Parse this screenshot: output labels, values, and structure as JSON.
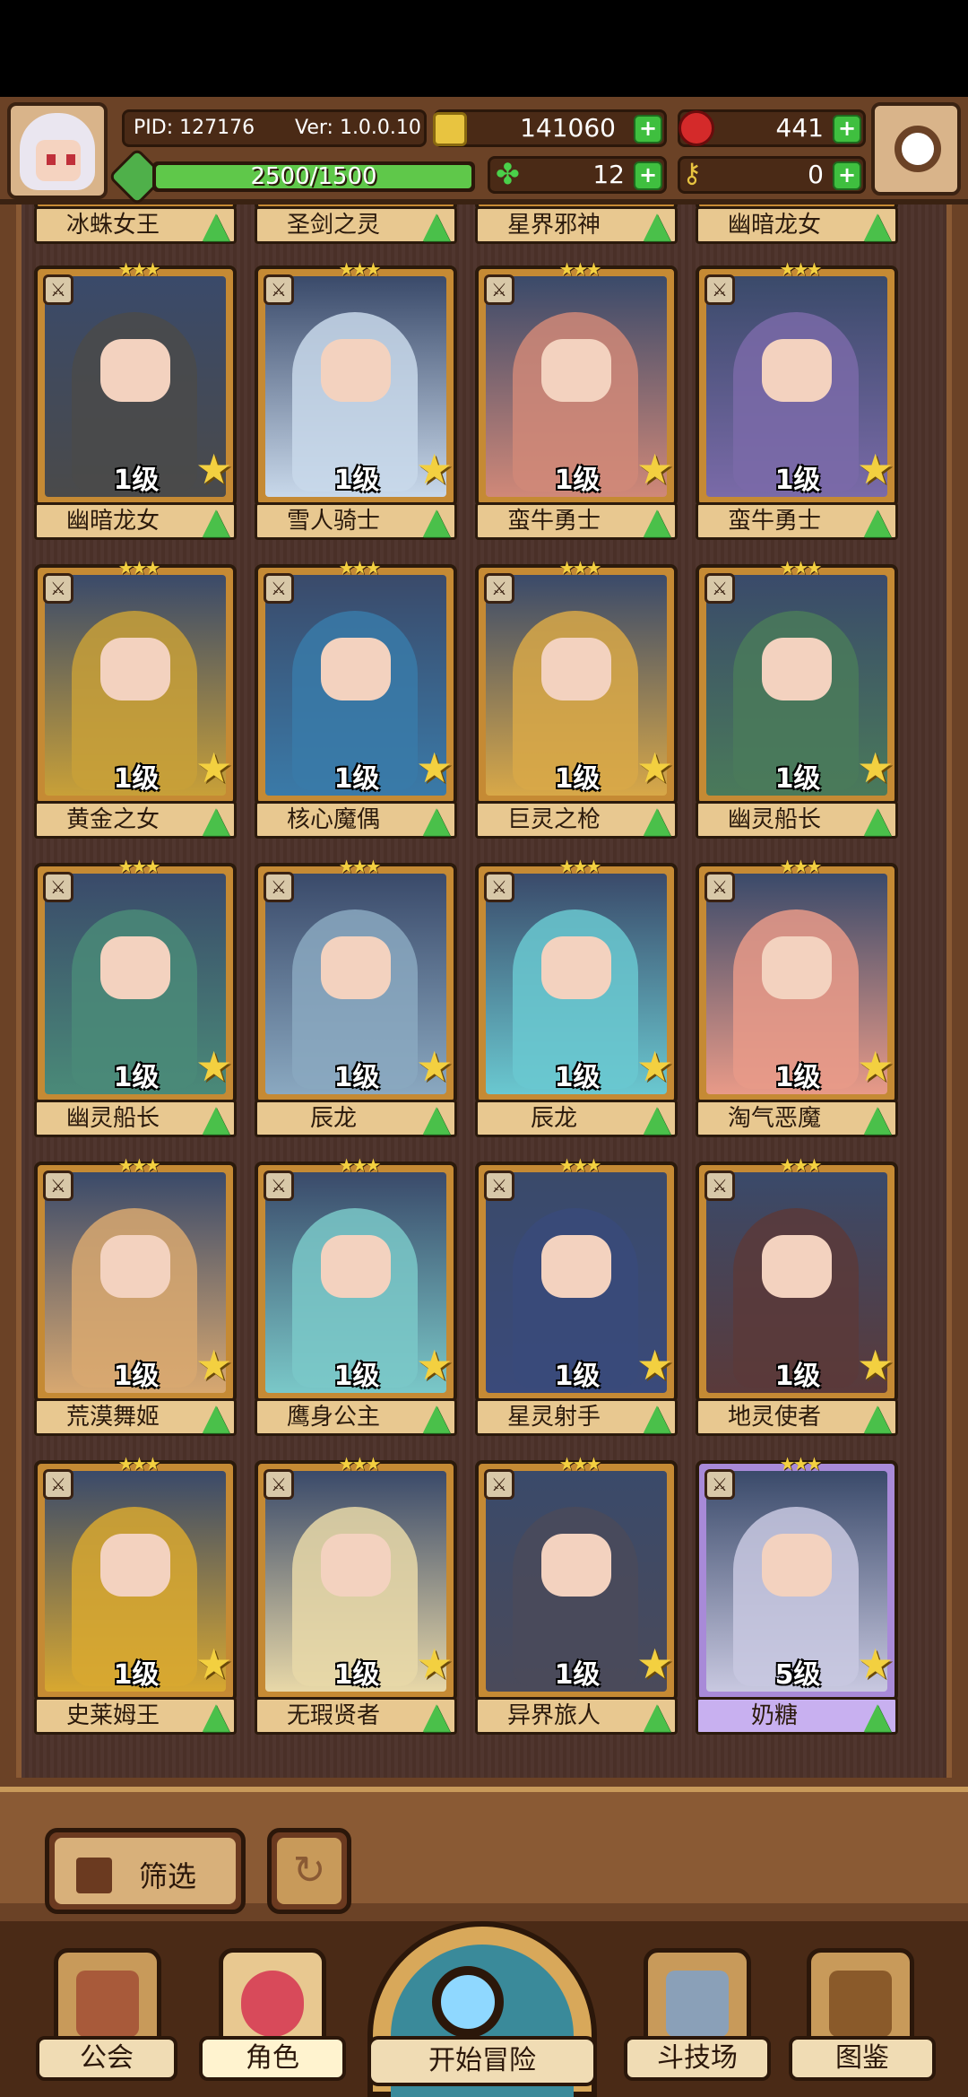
{
  "hud": {
    "pid": "PID: 127176",
    "ver": "Ver: 1.0.0.10",
    "coins": "141060",
    "gems": "441",
    "xp": "2500/1500",
    "xp_fraction": 1.0,
    "clovers": "12",
    "keys": "0",
    "plus": "+"
  },
  "top_partial_row": [
    {
      "name": "冰蛛女王"
    },
    {
      "name": "圣剑之灵"
    },
    {
      "name": "星界邪神"
    },
    {
      "name": "幽暗龙女"
    }
  ],
  "cards": [
    {
      "name": "幽暗龙女",
      "level": "1级",
      "color": "#4a4a4a"
    },
    {
      "name": "雪人骑士",
      "level": "1级",
      "color": "#c8d8ea"
    },
    {
      "name": "蛮牛勇士",
      "level": "1级",
      "color": "#d08878"
    },
    {
      "name": "蛮牛勇士",
      "level": "1级",
      "color": "#7a6aa8"
    },
    {
      "name": "黄金之女",
      "level": "1级",
      "color": "#c8a038"
    },
    {
      "name": "核心魔偶",
      "level": "1级",
      "color": "#3a7aa8"
    },
    {
      "name": "巨灵之枪",
      "level": "1级",
      "color": "#d8a848"
    },
    {
      "name": "幽灵船长",
      "level": "1级",
      "color": "#4a7a5a"
    },
    {
      "name": "幽灵船长",
      "level": "1级",
      "color": "#4a8a78"
    },
    {
      "name": "辰龙",
      "level": "1级",
      "color": "#8aa8c0"
    },
    {
      "name": "辰龙",
      "level": "1级",
      "color": "#6ac8d0"
    },
    {
      "name": "淘气恶魔",
      "level": "1级",
      "color": "#e89a88"
    },
    {
      "name": "荒漠舞姬",
      "level": "1级",
      "color": "#d8a870"
    },
    {
      "name": "鹰身公主",
      "level": "1级",
      "color": "#7ac8c8"
    },
    {
      "name": "星灵射手",
      "level": "1级",
      "color": "#3a4a7a"
    },
    {
      "name": "地灵使者",
      "level": "1级",
      "color": "#5a3a3a"
    },
    {
      "name": "史莱姆王",
      "level": "1级",
      "color": "#d8a830"
    },
    {
      "name": "无瑕贤者",
      "level": "1级",
      "color": "#e8d8a8"
    },
    {
      "name": "异界旅人",
      "level": "1级",
      "color": "#4a4a5a"
    },
    {
      "name": "奶糖",
      "level": "5级",
      "color": "#c8c8e0"
    }
  ],
  "stars": "★★★",
  "star_glyph": "★",
  "arrow_glyph": "▲",
  "controls": {
    "filter": "筛选"
  },
  "nav": {
    "guild": "公会",
    "role": "角色",
    "adventure": "开始冒险",
    "arena": "斗技场",
    "codex": "图鉴"
  }
}
